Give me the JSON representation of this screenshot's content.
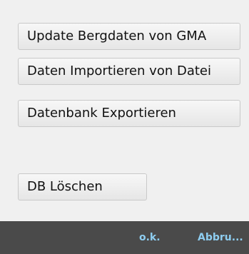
{
  "actions": {
    "update_label": "Update Bergdaten von GMA",
    "import_label": "Daten Importieren von Datei",
    "export_label": "Datenbank Exportieren",
    "delete_label": "DB Löschen"
  },
  "footer": {
    "ok_label": "o.k.",
    "cancel_label": "Abbru..."
  },
  "colors": {
    "footer_background": "#4a4a4a",
    "footer_text": "#8ecdf0"
  }
}
